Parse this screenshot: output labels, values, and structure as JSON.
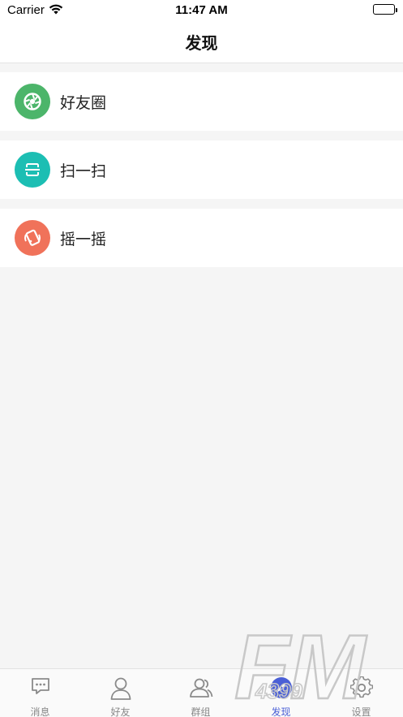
{
  "status_bar": {
    "carrier": "Carrier",
    "time": "11:47 AM",
    "wifi_icon": "wifi-icon",
    "battery_icon": "battery-icon"
  },
  "nav": {
    "title": "发现"
  },
  "menu": {
    "items": [
      {
        "label": "好友圈",
        "icon": "camera-aperture-icon",
        "color": "#4CB56A"
      },
      {
        "label": "扫一扫",
        "icon": "scan-icon",
        "color": "#1CBEB3"
      },
      {
        "label": "摇一摇",
        "icon": "shake-icon",
        "color": "#F0725A"
      }
    ]
  },
  "tabs": [
    {
      "label": "消息",
      "icon": "chat-bubble-icon",
      "active": false
    },
    {
      "label": "好友",
      "icon": "person-icon",
      "active": false
    },
    {
      "label": "群组",
      "icon": "group-icon",
      "active": false
    },
    {
      "label": "发现",
      "icon": "compass-icon",
      "active": true
    },
    {
      "label": "设置",
      "icon": "gear-icon",
      "active": false
    }
  ],
  "watermark": {
    "text_large": "FM",
    "text_small": "4399"
  },
  "colors": {
    "active_tab": "#4a5fd6",
    "inactive_tab": "#888888",
    "background": "#f5f5f5"
  }
}
